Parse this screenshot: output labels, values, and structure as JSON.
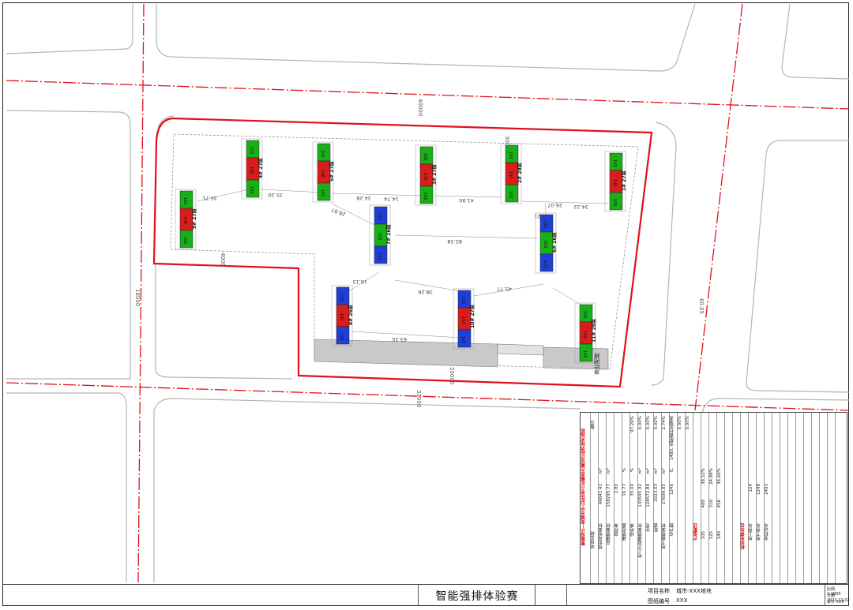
{
  "drawing": {
    "road_labels": [
      "40000",
      "18000",
      "60.05",
      "32000",
      "20000"
    ],
    "site_labels": [
      "4000",
      "3000"
    ],
    "distances": [
      "35.71",
      "35.20",
      "34.28",
      "14.74",
      "28.87",
      "41.90",
      "26.07",
      "34.22",
      "85.58",
      "16.15",
      "38.26",
      "45.77",
      "16.21",
      "63.15"
    ],
    "buildings": [
      {
        "id": "b1",
        "floors": "27层",
        "code": "9#"
      },
      {
        "id": "b2",
        "floors": "27层",
        "code": "4#"
      },
      {
        "id": "b3",
        "floors": "27层",
        "code": "5#"
      },
      {
        "id": "b4",
        "floors": "27层",
        "code": "3#"
      },
      {
        "id": "b5",
        "floors": "28层",
        "code": "2#"
      },
      {
        "id": "b6",
        "floors": "27层",
        "code": "1#"
      },
      {
        "id": "b7",
        "floors": "26层",
        "code": "7#"
      },
      {
        "id": "b8",
        "floors": "26层",
        "code": "6#"
      },
      {
        "id": "b9",
        "floors": "26层",
        "code": "8#"
      },
      {
        "id": "b10",
        "floors": "27层",
        "code": "10#"
      },
      {
        "id": "b11",
        "floors": "28层",
        "code": "11#"
      }
    ],
    "commercial_label": "商业配套",
    "commercial_floors": "2层",
    "unit_labels": {
      "green": "105",
      "red": "140",
      "blue": "125"
    }
  },
  "colors": {
    "red_line": "#e0101a",
    "green_unit": "#17b117",
    "red_unit": "#d91c1c",
    "blue_unit": "#1f3fd8",
    "road": "#bbb",
    "commercial": "#c9c9c9"
  },
  "indicator_table": {
    "title": "智能设计—某城市中心区住宅小区概念方案设计经济技术指标",
    "header_col1": "项目名称",
    "header_col2": "数值",
    "header_col3": "备注",
    "rows": [
      {
        "name": "规划用地面积",
        "unit": "m²",
        "value": "46641.41"
      },
      {
        "name": "总建筑面积",
        "unit": "m²",
        "value": "158295.77"
      },
      {
        "name": "容积率",
        "unit": "",
        "value": "2.80"
      },
      {
        "name": "建筑密度",
        "unit": "%",
        "value": "16.77"
      },
      {
        "name": "绿地率",
        "unit": "%",
        "value": "35.00"
      },
      {
        "name": "地上计容建筑面积",
        "unit": "m²",
        "value": "130595.92"
      },
      {
        "name": "住宅",
        "unit": "m²",
        "value": "128572.89"
      },
      {
        "name": "配套",
        "unit": "m²",
        "value": "2023.03"
      },
      {
        "name": "地下建筑面积",
        "unit": "m²",
        "value": "27699.85"
      },
      {
        "name": "总户数",
        "unit": "户",
        "value": "1246"
      }
    ],
    "notes": [
      "97.26%",
      "0.00%",
      "0.00%",
      "0.00%",
      "2.74%",
      "1480, 含配套社区服务",
      "0.00%",
      "0.00%"
    ],
    "unit_mix_title": "户型配比",
    "unit_mix": [
      {
        "type": "105",
        "count": "480",
        "ratio": "38.52%"
      },
      {
        "type": "125",
        "count": "310",
        "ratio": "24.88%"
      },
      {
        "type": "140",
        "count": "456",
        "ratio": "36.60%"
      }
    ],
    "parking_title": "机动车停车位",
    "parking": [
      {
        "name": "地上停车",
        "value": "124"
      },
      {
        "name": "地下停车",
        "value": "1248"
      },
      {
        "name": "非机动车",
        "value": "2493"
      }
    ]
  },
  "title_block": {
    "drawing_title": "智能强排体验赛",
    "project_label": "项目名称",
    "project_value": "城市-XXX地块",
    "drawing_no_label": "图纸编号",
    "drawing_no_value": "XXX",
    "sign_rows": [
      "比例 1:1000",
      "日期 2021.11.02",
      "设计 XXX"
    ]
  }
}
